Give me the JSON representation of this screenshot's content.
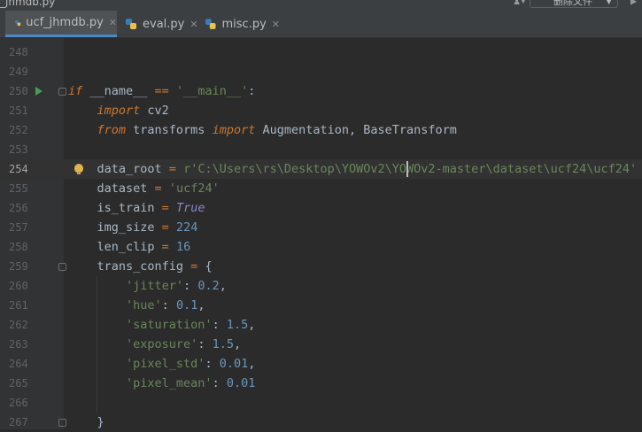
{
  "window": {
    "file_title": "_jhmdb.py",
    "action_button_label": "删除文件"
  },
  "tabs": [
    {
      "label": "ucf_jhmdb.py",
      "active": true
    },
    {
      "label": "eval.py",
      "active": false
    },
    {
      "label": "misc.py",
      "active": false
    }
  ],
  "editor": {
    "current_line": 254,
    "lines": [
      {
        "n": "248",
        "tokens": []
      },
      {
        "n": "249",
        "tokens": []
      },
      {
        "n": "250",
        "tokens": [
          [
            "kw",
            "if"
          ],
          [
            "p",
            " __name__ "
          ],
          [
            "op",
            "=="
          ],
          [
            "p",
            " "
          ],
          [
            "str",
            "'__main__'"
          ],
          [
            "p",
            ":"
          ]
        ]
      },
      {
        "n": "251",
        "tokens": [
          [
            "p",
            "    "
          ],
          [
            "kw",
            "import"
          ],
          [
            "p",
            " cv2"
          ]
        ]
      },
      {
        "n": "252",
        "tokens": [
          [
            "p",
            "    "
          ],
          [
            "kw",
            "from"
          ],
          [
            "p",
            " transforms "
          ],
          [
            "kw",
            "import"
          ],
          [
            "p",
            " Augmentation, BaseTransform"
          ]
        ]
      },
      {
        "n": "253",
        "tokens": []
      },
      {
        "n": "254",
        "tokens": [
          [
            "p",
            "    data_root "
          ],
          [
            "op",
            "="
          ],
          [
            "p",
            " "
          ],
          [
            "str",
            "r'C:\\Users\\rs\\Desktop\\YOWOv2\\YOWOv2-master\\dataset\\ucf24\\ucf24'"
          ]
        ]
      },
      {
        "n": "255",
        "tokens": [
          [
            "p",
            "    dataset "
          ],
          [
            "op",
            "="
          ],
          [
            "p",
            " "
          ],
          [
            "str",
            "'ucf24'"
          ]
        ]
      },
      {
        "n": "256",
        "tokens": [
          [
            "p",
            "    is_train "
          ],
          [
            "op",
            "="
          ],
          [
            "p",
            " "
          ],
          [
            "tv",
            "True"
          ]
        ]
      },
      {
        "n": "257",
        "tokens": [
          [
            "p",
            "    img_size "
          ],
          [
            "op",
            "="
          ],
          [
            "p",
            " "
          ],
          [
            "num",
            "224"
          ]
        ]
      },
      {
        "n": "258",
        "tokens": [
          [
            "p",
            "    len_clip "
          ],
          [
            "op",
            "="
          ],
          [
            "p",
            " "
          ],
          [
            "num",
            "16"
          ]
        ]
      },
      {
        "n": "259",
        "tokens": [
          [
            "p",
            "    trans_config "
          ],
          [
            "op",
            "="
          ],
          [
            "p",
            " {"
          ]
        ]
      },
      {
        "n": "260",
        "tokens": [
          [
            "p",
            "        "
          ],
          [
            "str",
            "'jitter'"
          ],
          [
            "p",
            ": "
          ],
          [
            "num",
            "0.2"
          ],
          [
            "p",
            ","
          ]
        ]
      },
      {
        "n": "261",
        "tokens": [
          [
            "p",
            "        "
          ],
          [
            "str",
            "'hue'"
          ],
          [
            "p",
            ": "
          ],
          [
            "num",
            "0.1"
          ],
          [
            "p",
            ","
          ]
        ]
      },
      {
        "n": "262",
        "tokens": [
          [
            "p",
            "        "
          ],
          [
            "str",
            "'saturation'"
          ],
          [
            "p",
            ": "
          ],
          [
            "num",
            "1.5"
          ],
          [
            "p",
            ","
          ]
        ]
      },
      {
        "n": "263",
        "tokens": [
          [
            "p",
            "        "
          ],
          [
            "str",
            "'exposure'"
          ],
          [
            "p",
            ": "
          ],
          [
            "num",
            "1.5"
          ],
          [
            "p",
            ","
          ]
        ]
      },
      {
        "n": "264",
        "tokens": [
          [
            "p",
            "        "
          ],
          [
            "str",
            "'pixel_std'"
          ],
          [
            "p",
            ": "
          ],
          [
            "num",
            "0.01"
          ],
          [
            "p",
            ","
          ]
        ]
      },
      {
        "n": "265",
        "tokens": [
          [
            "p",
            "        "
          ],
          [
            "str",
            "'pixel_mean'"
          ],
          [
            "p",
            ": "
          ],
          [
            "num",
            "0.01"
          ]
        ]
      },
      {
        "n": "266",
        "tokens": []
      },
      {
        "n": "267",
        "tokens": [
          [
            "p",
            "    }"
          ]
        ]
      }
    ]
  },
  "colors": {
    "background": "#2b2b2b",
    "keyword": "#cc7832",
    "string": "#6a8759",
    "number": "#6897bb",
    "tab_underline": "#4a88c7",
    "run_icon": "#499c54",
    "bulb": "#e0b34d"
  }
}
